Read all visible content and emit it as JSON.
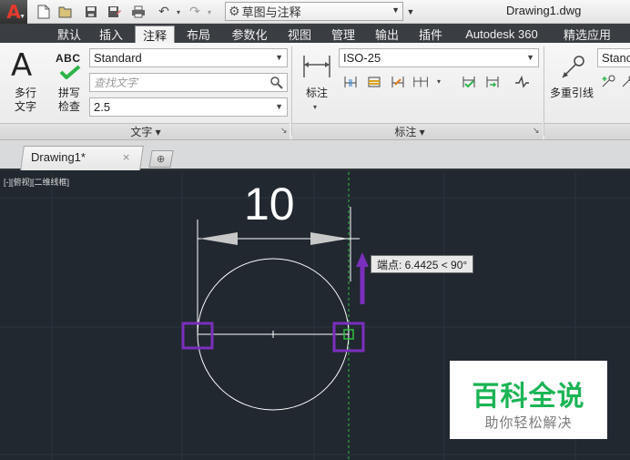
{
  "title_bar": {
    "app_logo": "A",
    "workspace": "草图与注释",
    "document_title": "Drawing1.dwg",
    "qat_icons": [
      "new-icon",
      "open-icon",
      "save-icon",
      "save-as-icon",
      "plot-icon",
      "undo-icon",
      "redo-icon"
    ]
  },
  "ribbon_tabs": [
    {
      "label": "默认",
      "active": false
    },
    {
      "label": "插入",
      "active": false
    },
    {
      "label": "注释",
      "active": true
    },
    {
      "label": "布局",
      "active": false
    },
    {
      "label": "参数化",
      "active": false
    },
    {
      "label": "视图",
      "active": false
    },
    {
      "label": "管理",
      "active": false
    },
    {
      "label": "输出",
      "active": false
    },
    {
      "label": "插件",
      "active": false
    },
    {
      "label": "Autodesk 360",
      "active": false
    },
    {
      "label": "精选应用",
      "active": false
    }
  ],
  "text_panel": {
    "multiline_text_label_line1": "多行",
    "multiline_text_label_line2": "文字",
    "spell_check_label_line1": "拼写",
    "spell_check_label_line2": "检查",
    "abc_label": "ABC",
    "text_style": "Standard",
    "find_placeholder": "查找文字",
    "text_height": "2.5",
    "panel_title": "文字"
  },
  "dimension_panel": {
    "dimension_label": "标注",
    "dim_style": "ISO-25",
    "panel_title": "标注"
  },
  "leader_panel": {
    "multileader_label": "多重引线",
    "leader_style": "Stanc"
  },
  "file_tabs": {
    "active_tab": "Drawing1*",
    "close_glyph": "×"
  },
  "canvas": {
    "viewport_label": "[-][俯视][二维线框]",
    "dimension_value": "10",
    "tooltip": "端点: 6.4425 < 90°"
  },
  "colors": {
    "canvas_bg": "#212830",
    "highlight": "#7b2fbe",
    "ribbon_tabs_bg": "#3a3d42"
  },
  "watermark": {
    "title": "百科全说",
    "subtitle": "助你轻松解决"
  }
}
